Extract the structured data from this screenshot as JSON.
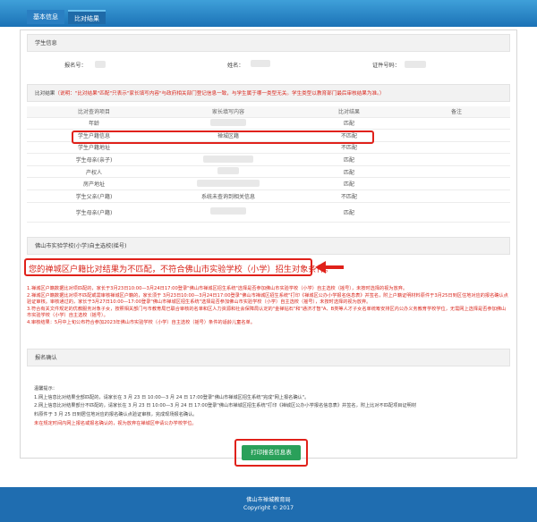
{
  "tabs": [
    {
      "label": "基本信息"
    },
    {
      "label": "比对结果"
    }
  ],
  "student": {
    "section_title": "学生信息",
    "name_label": "报名号：",
    "full_name_label": "姓名：",
    "id_label": "证件号码："
  },
  "compare": {
    "section_label": "比对结果",
    "note": "（说明：\"比对结果\"匹配\"只表示\"家长填写内容\"与政府相关部门登记信息一致，与学生属于哪一类型无关。学生类型以教育部门最后审核结果为准。）",
    "headers": [
      "比对查询项目",
      "家长填写内容",
      "比对结果",
      "备注"
    ],
    "rows": [
      {
        "item": "年龄",
        "value": "",
        "result": "匹配",
        "status": "ok"
      },
      {
        "item": "学生户籍信息",
        "value": "禅城区籍",
        "result": "不匹配",
        "status": "bad"
      },
      {
        "item": "学生户籍地址",
        "value": "",
        "result": "不匹配",
        "status": "bad"
      },
      {
        "item": "学生母亲(亲子)",
        "value": "",
        "result": "匹配",
        "status": "ok"
      },
      {
        "item": "产权人",
        "value": "",
        "result": "匹配",
        "status": "ok"
      },
      {
        "item": "房产地址",
        "value": "",
        "result": "匹配",
        "status": "ok"
      },
      {
        "item": "学生父亲(户籍)",
        "value": "系统未查询到相关信息",
        "result": "不匹配",
        "status": "bad"
      },
      {
        "item": "学生母亲(户籍)",
        "value": "",
        "result": "匹配",
        "status": "ok"
      }
    ]
  },
  "school": {
    "section_title": "佛山市实验学校(小学)自主选校(摇号)",
    "message": "您的禅城区户籍比对结果为不匹配，不符合佛山市实验学校（小学）招生对象条件。",
    "notes": [
      "1.禅城区户籍数据比对项匹配的，家长于3月23日10:00—3月24日17:00登录\"佛山市禅城区招生系统\"选择是否参加佛山市实验学校（小学）自主选校（摇号），未按时选择的视为放弃。",
      "2.禅城区户籍数据比对项不匹配或需审核禅城区户籍的，家长须于 3月23日10:00—3月24日17:00登录\"佛山市禅城区招生系统\"打印《禅城区公办小学报名信息表》并签名，附上户籍证明材料原件于3月25日到区住地对应的报名确认点验证审核。审核通过的，家长于3月27日10:00—17:00登录\"佛山市禅城区招生系统\"选择是否参加佛山市实验学校（小学）自主选校（摇号），未按时选择的视为放弃。",
      "3.符合有关文件规定的优教服务对象子女，按照相关部门与市教育局已联合审核的名单和区人力资源和社会保障局认定的\"金禅钻石\"和\"通济才智\"A、B类等人才子女名单统筹安排区内公办义务教育学校学位，无需网上选择是否参加佛山市实验学校（小学）自主选校（摇号）。",
      "4.审核结果：5月中上旬公布符合参加2023年佛山市实验学校（小学）自主选校（摇号）条件的适龄儿童名单。"
    ]
  },
  "confirm": {
    "section_title": "报名确认",
    "tip_title": "温馨提示：",
    "lines": [
      "1.网上信息比对结果全部匹配的，请家长在 3 月 23 日 10:00—3 月 24 日 17:00登录\"佛山市禅城区招生系统\"完成\"网上报名确认\"。",
      "2.网上信息比对结果部分不匹配的，请家长在 3 月 23 日 10:00—3 月 24 日 17:00登录\"佛山市禅城区招生系统\"打印《禅城区公办小学报名信息表》并签名，附上比对不匹配项目证明材",
      "料原件于 3 月 25 日到居住地对应的报名确认点验证审核，完成现场报名确认。"
    ],
    "warning": "未在规定时间内网上报名或报名确认的，视为放弃在禅城区申请公办学校学位。",
    "print_button": "打印报名信息表"
  },
  "footer": {
    "line1": "佛山市禅城教育局",
    "line2": "Copyright © 2017"
  }
}
